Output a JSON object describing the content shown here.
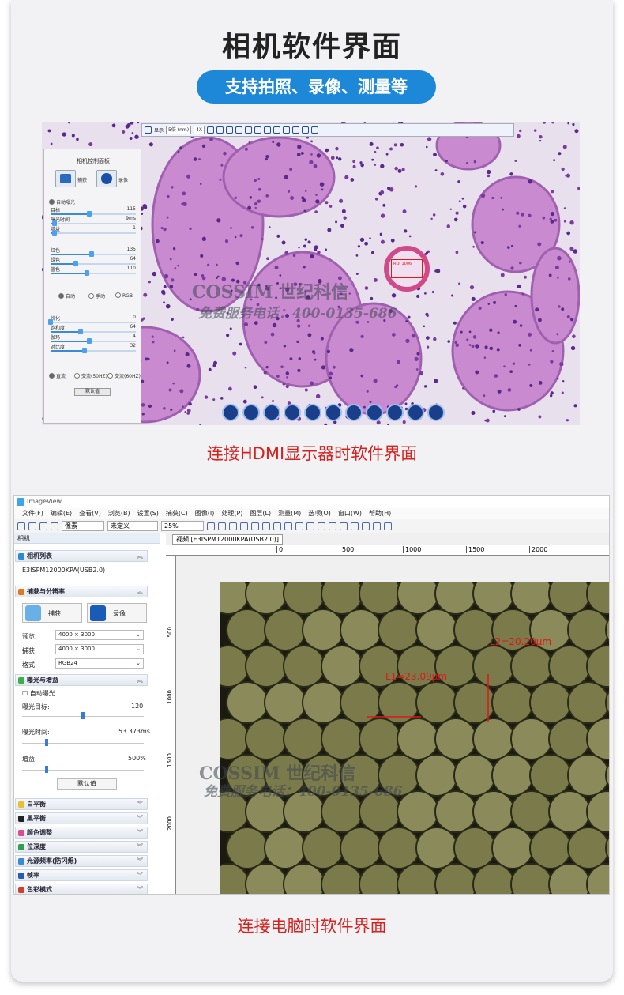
{
  "page": {
    "title": "相机软件界面",
    "pill": "支持拍照、录像、测量等",
    "caption_hdmi": "连接HDMI显示器时软件界面",
    "caption_pc": "连接电脑时软件界面",
    "accent_blue": "#1e88d8",
    "caption_red": "#d6211e"
  },
  "watermark": {
    "brand": "COSSIM 世纪科信",
    "hotline": "免费服务电话：400-0135-686"
  },
  "hdmi_ui": {
    "toolbar": {
      "show": "显示",
      "select1": "5倍 (nm)",
      "select2": "4X"
    },
    "roi_label": "ROI 1006",
    "panel": {
      "title": "相机控制面板",
      "capture": "捕获",
      "record": "录像",
      "auto_exposure": "自动曝光",
      "rows": [
        {
          "label": "目标",
          "value": "115",
          "level": 0.45
        },
        {
          "label": "曝光时间",
          "value": "9ms",
          "level": 0.05
        },
        {
          "label": "增益",
          "value": "1",
          "level": 0.05
        },
        {
          "label": "红色",
          "value": "135",
          "level": 0.48
        },
        {
          "label": "绿色",
          "value": "64",
          "level": 0.3
        },
        {
          "label": "蓝色",
          "value": "110",
          "level": 0.43
        },
        {
          "label": "锐化",
          "value": "0",
          "level": 0.0
        },
        {
          "label": "饱和度",
          "value": "64",
          "level": 0.35
        },
        {
          "label": "伽玛",
          "value": "4",
          "level": 0.45
        },
        {
          "label": "对比度",
          "value": "32",
          "level": 0.4
        }
      ],
      "wb_modes": [
        "自动",
        "手动",
        "RGB"
      ],
      "power_modes": [
        "直流",
        "交流(50HZ)",
        "交流(60HZ)"
      ],
      "default_btn": "默认值"
    }
  },
  "pc_ui": {
    "app_title": "ImageView",
    "menus": [
      "文件(F)",
      "编辑(E)",
      "查看(V)",
      "浏览(B)",
      "设置(S)",
      "捕获(C)",
      "图像(I)",
      "处理(P)",
      "图层(L)",
      "测量(M)",
      "选项(O)",
      "窗口(W)",
      "帮助(H)"
    ],
    "toolbar": {
      "unit": "像素",
      "mag": "未定义",
      "zoom": "25%"
    },
    "panel_title": "相机",
    "sections": {
      "camera_list": "相机列表",
      "camera_name": "E3ISPM12000KPA(USB2.0)",
      "capture_res": "捕获与分辨率",
      "capture_btn": "捕获",
      "record_btn": "录像",
      "preview_label": "预览:",
      "preview_value": "4000 × 3000",
      "capture_label": "捕获:",
      "capture_value": "4000 × 3000",
      "format_label": "格式:",
      "format_value": "RGB24",
      "exposure_gain": "曝光与增益",
      "auto_exposure": "自动曝光",
      "target_label": "曝光目标:",
      "target_value": "120",
      "target_level": 0.5,
      "time_label": "曝光时间:",
      "time_value": "53.373ms",
      "time_level": 0.2,
      "gain_label": "增益:",
      "gain_value": "500%",
      "gain_level": 0.2,
      "default_btn": "默认值"
    },
    "collapsed": [
      "白平衡",
      "黑平衡",
      "颜色调整",
      "位深度",
      "光源频率(防闪烁)",
      "帧率",
      "色彩模式"
    ],
    "view_tab": "视频 [E3ISPM12000KPA(USB2.0)]",
    "ruler_h": [
      "0",
      "500",
      "1000",
      "1500",
      "2000"
    ],
    "ruler_v": [
      "500",
      "1000",
      "1500",
      "2000"
    ],
    "measurements": {
      "L1": "L1=23.09μm",
      "L2": "L2=20.20μm"
    }
  }
}
